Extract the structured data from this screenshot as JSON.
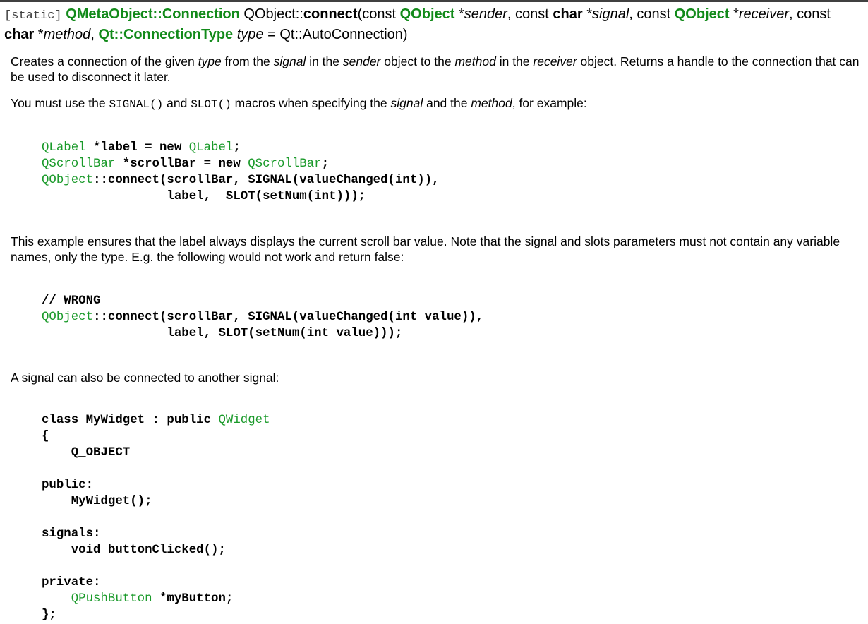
{
  "signature": {
    "static_tag": "[static]",
    "return_type": "QMetaObject::Connection",
    "class_prefix": "QObject::",
    "function_name": "connect",
    "p1_pre": "(const ",
    "p1_type": "QObject",
    "p1_name": "sender",
    "p2_pre": ", const ",
    "p2_kw": "char",
    "p2_name": "signal",
    "p3_pre": ", const ",
    "p3_type": "QObject",
    "p3_name": "receiver",
    "p4_pre": ", const ",
    "p4_kw": "char",
    "p4_name": "method",
    "p5_type": "Qt::ConnectionType",
    "p5_name": "type",
    "p5_default": " = Qt::AutoConnection)"
  },
  "para1": {
    "a": "Creates a connection of the given ",
    "type": "type",
    "b": " from the ",
    "signal": "signal",
    "c": " in the ",
    "sender": "sender",
    "d": " object to the ",
    "method": "method",
    "e": " in the ",
    "receiver": "receiver",
    "f": " object. Returns a handle to the connection that can be used to disconnect it later."
  },
  "para2": {
    "a": "You must use the ",
    "signal_macro": "SIGNAL()",
    "b": " and ",
    "slot_macro": "SLOT()",
    "c": " macros when specifying the ",
    "signal": "signal",
    "d": " and the ",
    "method": "method",
    "e": ", for example:"
  },
  "code1": [
    "QLabel *label = new QLabel;",
    "QScrollBar *scrollBar = new QScrollBar;",
    "QObject::connect(scrollBar, SIGNAL(valueChanged(int)),",
    "                 label,  SLOT(setNum(int)));"
  ],
  "para3": "This example ensures that the label always displays the current scroll bar value. Note that the signal and slots parameters must not contain any variable names, only the type. E.g. the following would not work and return false:",
  "code2": [
    "// WRONG",
    "QObject::connect(scrollBar, SIGNAL(valueChanged(int value)),",
    "                 label, SLOT(setNum(int value)));"
  ],
  "para4": "A signal can also be connected to another signal:",
  "code3": [
    "class MyWidget : public QWidget",
    "{",
    "    Q_OBJECT",
    "",
    "public:",
    "    MyWidget();",
    "",
    "signals:",
    "    void buttonClicked();",
    "",
    "private:",
    "    QPushButton *myButton;",
    "};"
  ],
  "highlight_types": [
    "QLabel",
    "QScrollBar",
    "QObject",
    "QWidget",
    "QPushButton"
  ],
  "colors": {
    "link_green": "#128a1a",
    "code_type_green": "#1a9a2a",
    "top_rule": "#404040"
  }
}
